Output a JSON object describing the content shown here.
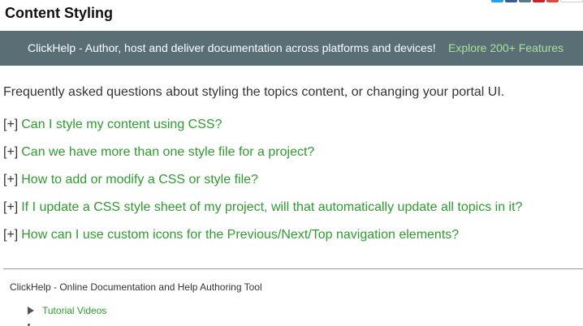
{
  "page": {
    "title": "Content Styling"
  },
  "share": {
    "icons": [
      {
        "name": "twitter-icon",
        "color": "#1da1f2"
      },
      {
        "name": "facebook-icon",
        "color": "#3b5998"
      },
      {
        "name": "linkedin-icon",
        "color": "#5a7a88"
      },
      {
        "name": "pinterest-icon",
        "color": "#cb2027"
      },
      {
        "name": "google-plus-icon",
        "color": "#dd4b39"
      }
    ]
  },
  "banner": {
    "text": "ClickHelp - Author, host and deliver documentation across platforms and devices!",
    "link": "Explore 200+ Features",
    "bg_color": "#5a6e76",
    "link_color": "#a6e39a"
  },
  "intro": "Frequently asked questions about styling the topics content, or changing your portal UI.",
  "faq": {
    "toggle": "[+]",
    "link_color": "#2e9b2e",
    "items": [
      "Can I style my content using CSS?",
      "Can we have more than one style file for a project?",
      "How to add or modify a CSS or style file?",
      "If I update a CSS style sheet of my project, will that automatically update all topics in it?",
      "How can I use custom icons for the Previous/Next/Top navigation elements?"
    ]
  },
  "footer": {
    "title": "ClickHelp - Online Documentation and Help Authoring Tool",
    "items": [
      {
        "label": "Tutorial Videos"
      }
    ],
    "link_color": "#2e9b2e"
  }
}
